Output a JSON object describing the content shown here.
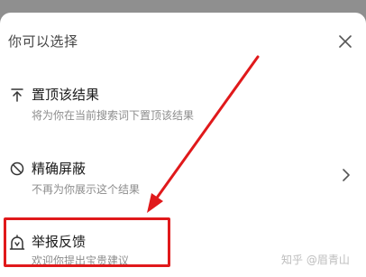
{
  "sheet": {
    "title": "你可以选择",
    "close_icon": "close-icon"
  },
  "options": [
    {
      "icon": "pin-top-icon",
      "title": "置顶该结果",
      "description": "将为你在当前搜索词下置顶该结果"
    },
    {
      "icon": "block-icon",
      "title": "精确屏蔽",
      "description": "不再为你展示这个结果",
      "has_chevron": true
    },
    {
      "icon": "report-icon",
      "title": "举报反馈",
      "description": "欢迎你提出宝贵建议",
      "highlighted": true
    }
  ],
  "annotation": {
    "color": "#e0191b"
  },
  "watermark": "知乎 @眉青山"
}
